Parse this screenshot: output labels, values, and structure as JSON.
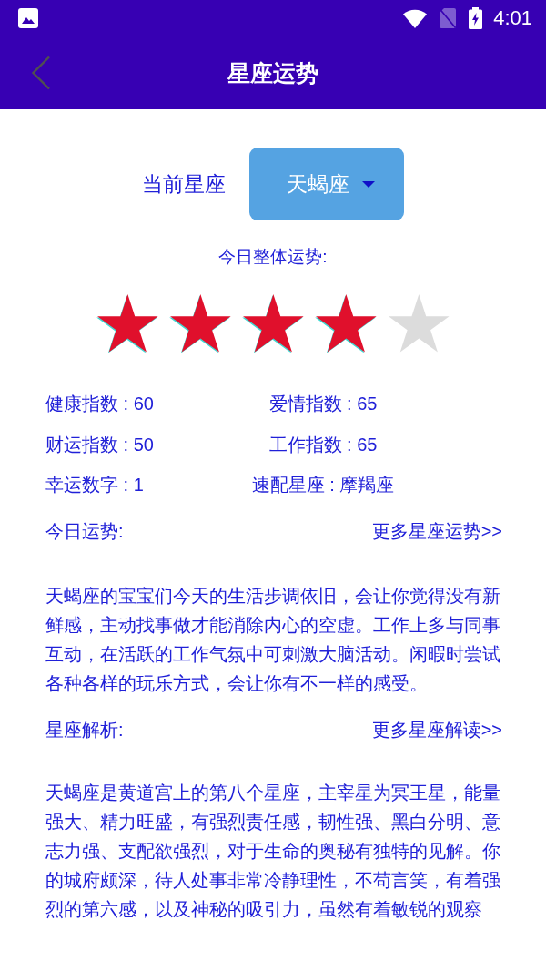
{
  "status_bar": {
    "time": "4:01"
  },
  "app_bar": {
    "title": "星座运势"
  },
  "sign_picker": {
    "label": "当前星座",
    "value": "天蝎座"
  },
  "overall": {
    "label": "今日整体运势:",
    "stars": 4
  },
  "indices": [
    "健康指数 : 60",
    "爱情指数 : 65",
    "财运指数 : 50",
    "工作指数 : 65",
    "幸运数字 : 1",
    "速配星座 : 摩羯座"
  ],
  "today": {
    "heading": "今日运势:",
    "link": "更多星座运势>>",
    "text": "天蝎座的宝宝们今天的生活步调依旧，会让你觉得没有新鲜感，主动找事做才能消除内心的空虚。工作上多与同事互动，在活跃的工作气氛中可刺激大脑活动。闲暇时尝试各种各样的玩乐方式，会让你有不一样的感受。"
  },
  "analysis": {
    "heading": "星座解析:",
    "link": "更多星座解读>>",
    "text": "天蝎座是黄道宫上的第八个星座，主宰星为冥王星，能量强大、精力旺盛，有强烈责任感，韧性强、黑白分明、意志力强、支配欲强烈，对于生命的奥秘有独特的见解。你的城府颇深，待人处事非常冷静理性，不苟言笑，有着强烈的第六感，以及神秘的吸引力，虽然有着敏锐的观察"
  }
}
